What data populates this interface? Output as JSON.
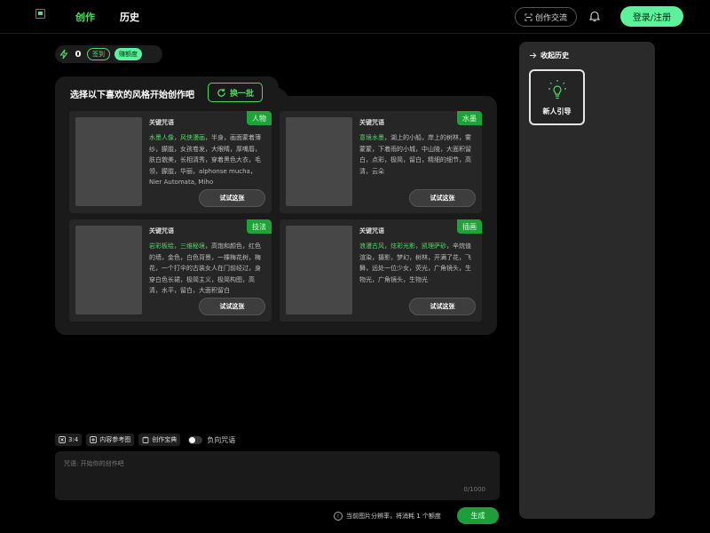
{
  "header": {
    "nav": [
      {
        "label": "创作",
        "active": true
      },
      {
        "label": "历史",
        "active": false
      }
    ],
    "community_label": "创作交流",
    "login_label": "登录/注册"
  },
  "credits": {
    "count": "0",
    "checkin_label": "签到",
    "earn_label": "赚额度"
  },
  "panel": {
    "title": "选择以下喜欢的风格开始创作吧",
    "refresh_label": "换一批",
    "cards": [
      {
        "tag": "人物",
        "kw_label": "关键咒语",
        "highlight": "水墨人像，风侠漫画",
        "text": "，半身，画面蒙着薄纱，朦胧，女孩卷发，大眼睛，厚嘴唇，肤白貌美，长相清秀，穿着黑色大衣，毛领，朦胧，华丽，alphonse mucha，Nier Automata, Miho",
        "button": "试试这张"
      },
      {
        "tag": "水墨",
        "kw_label": "关键咒语",
        "highlight": "意境水墨",
        "text": "，湖上的小船，岸上的树林，雾蒙蒙，下着雨的小城，中山陵，大面积留白，点彩，极简，留白，精细的细节，高清，云朵",
        "button": "试试这张"
      },
      {
        "tag": "技法",
        "kw_label": "关键咒语",
        "highlight": "岩彩板绘，三维秘境",
        "text": "，高饱和颜色，红色的墙，金色，白色背景，一棵梅花树，梅花，一个打伞的古装女人在门前经过，身穿白色长裙，极简主义，极简构图，高清，水平，留白，大面积留白",
        "button": "试试这张"
      },
      {
        "tag": "插画",
        "kw_label": "关键咒语",
        "highlight": "浪漫古风，炫彩光影，凯理萨砂",
        "text": "，辛烷值渲染，摄影，梦幻，树林，开满了花，飞舞，远处一位少女，荧光，广角镜头，生物光，广角镜头，生物光",
        "button": "试试这张"
      }
    ]
  },
  "toolbar": {
    "ratio_label": "3:4",
    "ref_image_label": "内容参考图",
    "treasure_label": "创作宝典",
    "negative_label": "负向咒语"
  },
  "prompt": {
    "placeholder": "咒语: 开始你的创作吧",
    "counter": "0/1000"
  },
  "footer": {
    "cost_note": "当前图片分辨率，将消耗 1 个额度",
    "generate_label": "生成"
  },
  "sidebar": {
    "collapse_label": "收起历史",
    "guide_label": "新人引导"
  },
  "colors": {
    "accent": "#53d769",
    "accent_bright": "#5af29a",
    "tag_bg": "#1ea33a",
    "panel_bg": "#1a1a1a",
    "card_bg": "#262626",
    "sidebar_bg": "#2a2a2a"
  },
  "icons": [
    "logo-icon",
    "scan-icon",
    "bell-icon",
    "zap-icon",
    "refresh-icon",
    "ratio-icon",
    "image-icon",
    "book-icon",
    "info-icon",
    "arrow-right-icon",
    "lightbulb-icon"
  ]
}
